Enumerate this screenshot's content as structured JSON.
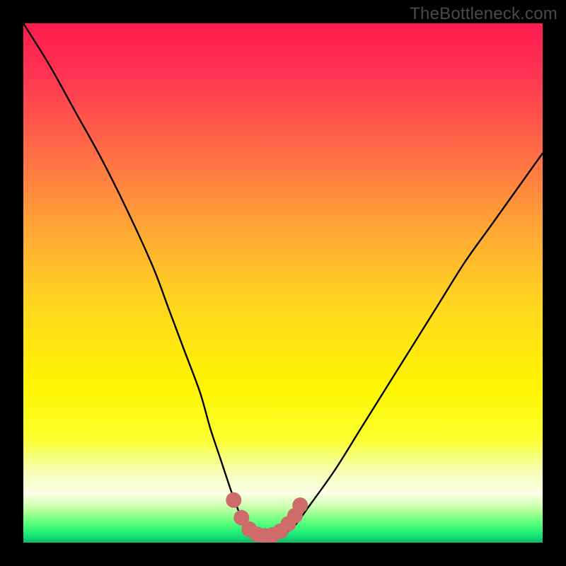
{
  "watermark": "TheBottleneck.com",
  "chart_data": {
    "type": "line",
    "title": "",
    "xlabel": "",
    "ylabel": "",
    "xlim": [
      0,
      100
    ],
    "ylim": [
      0,
      100
    ],
    "series": [
      {
        "name": "bottleneck-curve",
        "x": [
          0,
          5,
          10,
          15,
          20,
          25,
          28,
          31,
          34,
          36,
          38,
          40,
          41.5,
          43,
          45,
          47,
          49.5,
          52,
          55,
          60,
          65,
          70,
          75,
          80,
          85,
          90,
          95,
          100
        ],
        "y": [
          100,
          92,
          83,
          74,
          64,
          53,
          45,
          37,
          29,
          22,
          16,
          10,
          6,
          3,
          1.5,
          1.2,
          1.5,
          3,
          7,
          14,
          22,
          30,
          38,
          46,
          54,
          61,
          68,
          75
        ]
      }
    ],
    "markers": {
      "name": "highlight-points",
      "x": [
        40.5,
        42,
        43.5,
        45,
        46.5,
        48,
        49.5,
        51,
        52.3,
        53.3
      ],
      "y": [
        8.2,
        4.8,
        2.6,
        1.6,
        1.3,
        1.5,
        2.2,
        3.6,
        5.2,
        7.2
      ],
      "color": "#cf6b6b",
      "size": 11
    },
    "gradient_stops": [
      {
        "offset": 0.0,
        "color": "#ff1a4f"
      },
      {
        "offset": 0.1,
        "color": "#ff3552"
      },
      {
        "offset": 0.25,
        "color": "#ff6e46"
      },
      {
        "offset": 0.4,
        "color": "#ffa834"
      },
      {
        "offset": 0.55,
        "color": "#ffd91e"
      },
      {
        "offset": 0.7,
        "color": "#fff500"
      },
      {
        "offset": 0.8,
        "color": "#fbff2e"
      },
      {
        "offset": 0.86,
        "color": "#f4ffb0"
      },
      {
        "offset": 0.905,
        "color": "#fcffe8"
      },
      {
        "offset": 0.925,
        "color": "#d8ffba"
      },
      {
        "offset": 0.945,
        "color": "#9cff8f"
      },
      {
        "offset": 0.965,
        "color": "#4fff79"
      },
      {
        "offset": 0.985,
        "color": "#17e876"
      },
      {
        "offset": 1.0,
        "color": "#0fb867"
      }
    ]
  }
}
